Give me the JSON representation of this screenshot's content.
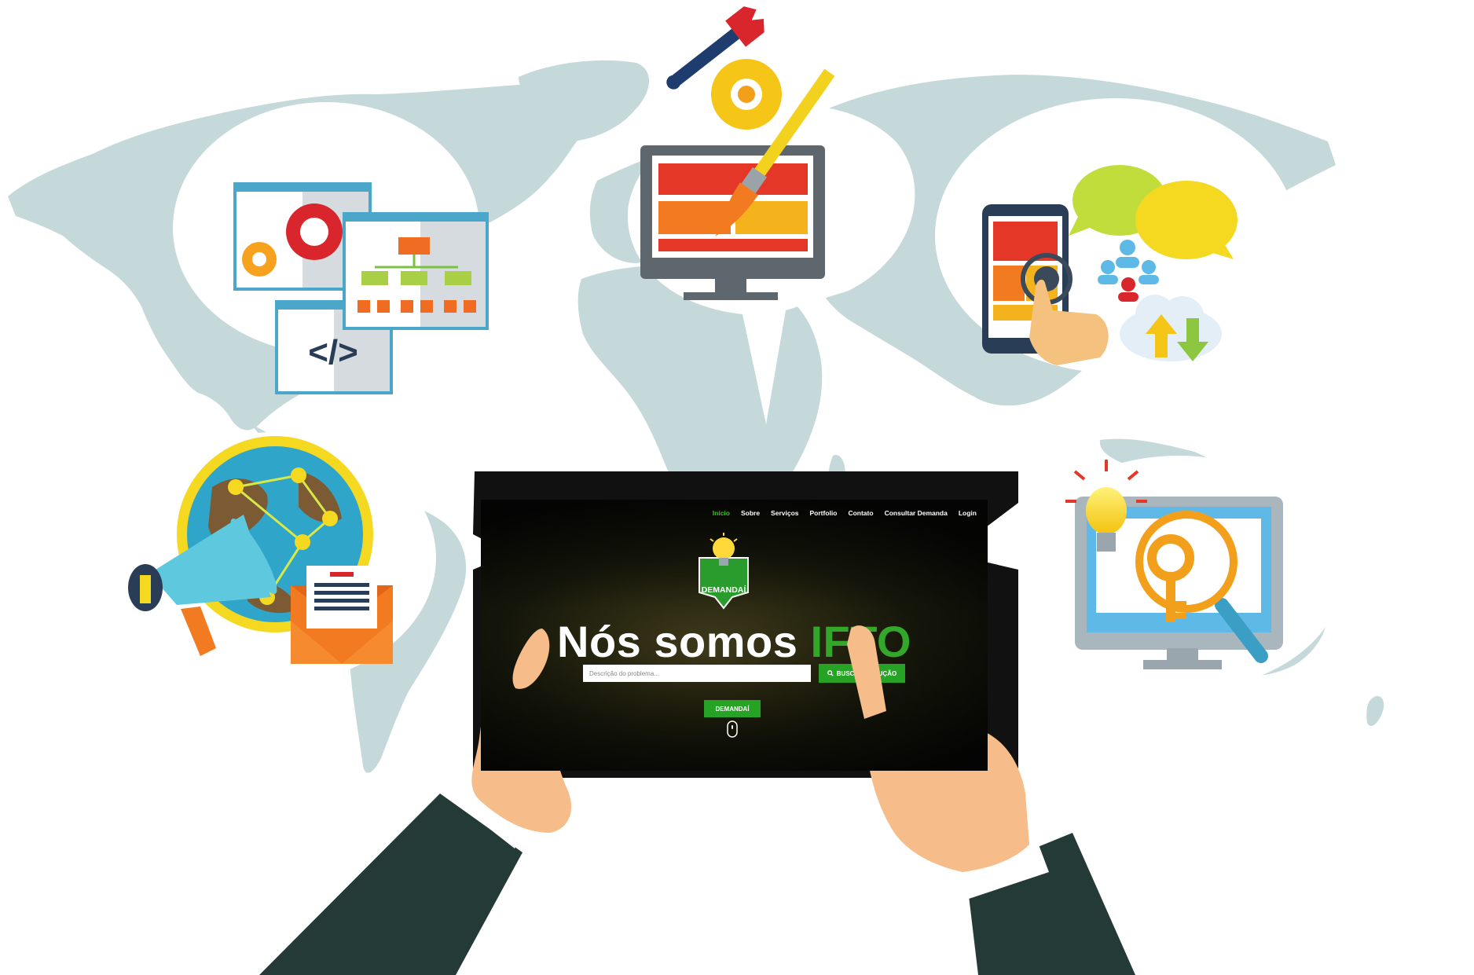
{
  "brand": {
    "primary_green": "#33a72a",
    "button_green": "#26a325",
    "map_color": "#c6d9da"
  },
  "website": {
    "nav": {
      "items": [
        "Início",
        "Sobre",
        "Serviços",
        "Portfolio",
        "Contato",
        "Consultar Demanda",
        "Login"
      ],
      "active": "Início"
    },
    "logo": {
      "label": "DEMANDAÍ",
      "icon": "lightbulb-icon"
    },
    "hero": {
      "title_prefix": "Nós somos ",
      "title_highlight": "IFTO"
    },
    "search": {
      "placeholder": "Descrição do problema...",
      "button_label": "BUSCAR SOLUÇÃO",
      "button_icon": "search-icon"
    },
    "cta_label": "DEMANDAÍ",
    "scroll_icon": "mouse-scroll-icon"
  },
  "illustrations": {
    "top_left": "web-windows-code-icon",
    "top_center": "monitor-design-tools-icon",
    "top_right": "mobile-social-cloud-icon",
    "middle_left": "marketing-globe-megaphone-icon",
    "middle_right": "seo-key-magnifier-icon",
    "bottom": "hands-holding-tablet"
  }
}
